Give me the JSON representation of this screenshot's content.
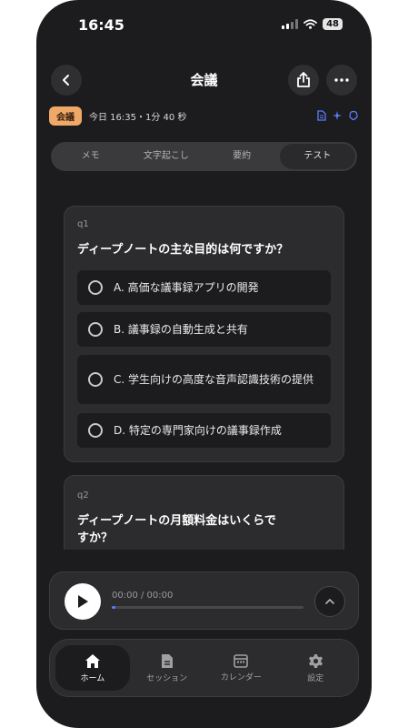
{
  "status_bar": {
    "time": "16:45",
    "battery": "48"
  },
  "header": {
    "title": "会議"
  },
  "meta": {
    "tag": "会議",
    "info": "今日 16:35・1分 40 秒"
  },
  "segments": [
    {
      "label": "メモ",
      "active": false
    },
    {
      "label": "文字起こし",
      "active": false
    },
    {
      "label": "要約",
      "active": false
    },
    {
      "label": "テスト",
      "active": true
    }
  ],
  "questions": [
    {
      "id": "q1",
      "text": "ディープノートの主な目的は何ですか？",
      "options": [
        "A. 高価な議事録アプリの開発",
        "B. 議事録の自動生成と共有",
        "C. 学生向けの高度な音声認識技術の提供",
        "D. 特定の専門家向けの議事録作成"
      ]
    },
    {
      "id": "q2",
      "text": "ディープノートの月額料金はいくらですか？",
      "options": []
    }
  ],
  "player": {
    "time": "00:00 / 00:00",
    "progress": 0.02
  },
  "tabs": [
    {
      "label": "ホーム",
      "icon": "home-icon",
      "active": true
    },
    {
      "label": "セッション",
      "icon": "document-icon",
      "active": false
    },
    {
      "label": "カレンダー",
      "icon": "calendar-icon",
      "active": false
    },
    {
      "label": "設定",
      "icon": "gear-icon",
      "active": false
    }
  ],
  "colors": {
    "accent": "#5a7cff",
    "tag": "#f0a868",
    "background": "#1c1c1e"
  }
}
